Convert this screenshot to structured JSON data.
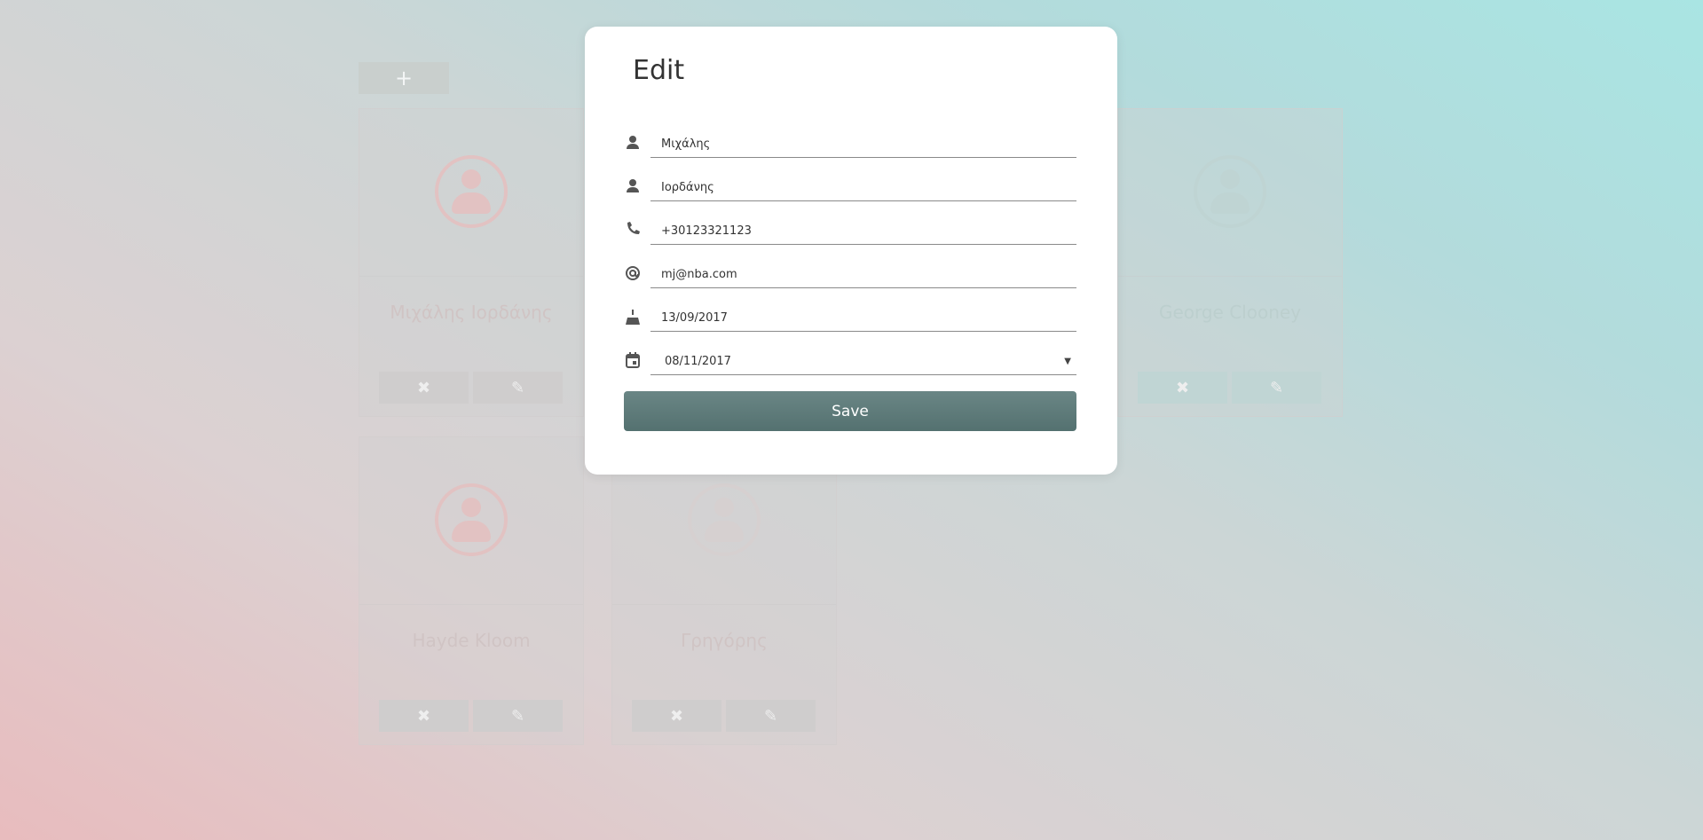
{
  "toolbar": {
    "add_label": "+"
  },
  "cards": [
    {
      "name": "Μιχάλης Ιορδάνης",
      "delete_label": "✖",
      "edit_label": "✎"
    },
    {
      "name": "George Clooney",
      "delete_label": "✖",
      "edit_label": "✎"
    },
    {
      "name": "Hayde Kloom",
      "delete_label": "✖",
      "edit_label": "✎"
    },
    {
      "name": "Γρηγόρης",
      "delete_label": "✖",
      "edit_label": "✎"
    }
  ],
  "modal": {
    "title": "Edit",
    "first_name": "Μιχάλης",
    "last_name": "Ιορδάνης",
    "phone": "+30123321123",
    "email": "mj@nba.com",
    "birthday": "13/09/2017",
    "date": "08/11/2017",
    "save_label": "Save"
  },
  "colors": {
    "save_button": "#5e7b7a",
    "icon": "#555555"
  },
  "icons": [
    "person-icon",
    "phone-icon",
    "at-icon",
    "cake-icon",
    "calendar-icon"
  ]
}
